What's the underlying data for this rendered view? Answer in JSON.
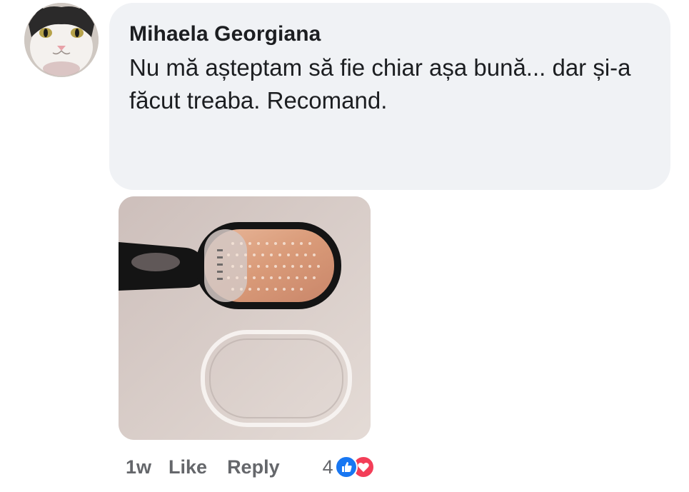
{
  "comment": {
    "author": "Mihaela Georgiana",
    "text": "Nu mă așteptam să fie chiar așa bună... dar și-a făcut treaba. Recomand.",
    "avatar_icon": "cat-avatar",
    "photo_description_icon": "foot-file-grater-photo"
  },
  "actions": {
    "timestamp": "1w",
    "like_label": "Like",
    "reply_label": "Reply",
    "reaction_count": "4",
    "reactions": [
      "like-reaction-icon",
      "love-reaction-icon"
    ]
  },
  "colors": {
    "bubble_bg": "#f0f2f5",
    "like_blue": "#1877f2",
    "love_red": "#f33e58",
    "meta_gray": "#65676b",
    "text_dark": "#1c1e21"
  }
}
